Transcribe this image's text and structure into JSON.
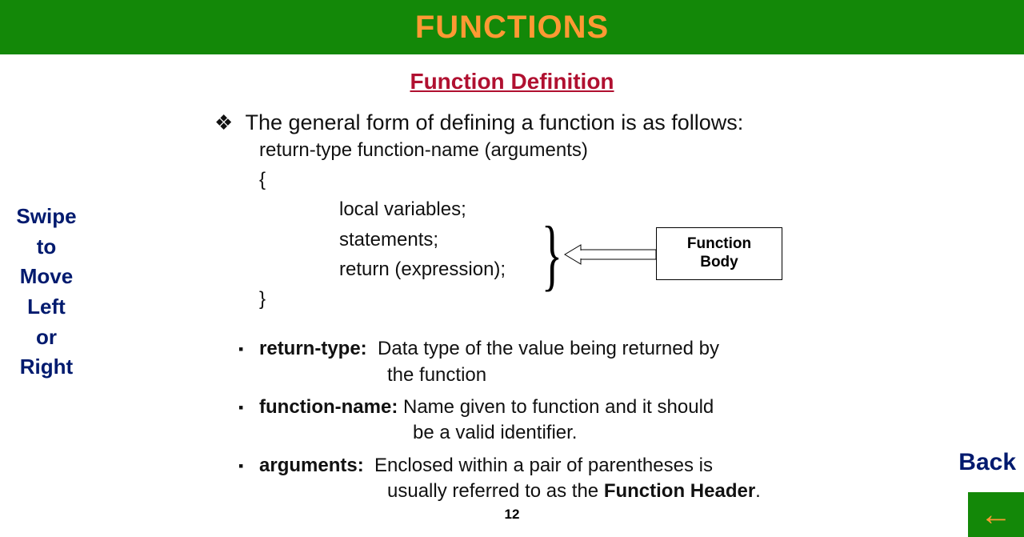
{
  "header": {
    "title": "FUNCTIONS"
  },
  "subtitle": "Function Definition",
  "swipe_hint": {
    "l1": "Swipe",
    "l2": "to",
    "l3": "Move",
    "l4": "Left",
    "l5": "or",
    "l6": "Right"
  },
  "lead": "The general form of defining a function is as follows:",
  "syntax": {
    "line1": "return-type   function-name (arguments)",
    "line2": "{",
    "line3": "local variables;",
    "line4": "statements;",
    "line5": "return (expression);",
    "line6": "}"
  },
  "callout": {
    "l1": "Function",
    "l2": "Body"
  },
  "defs": [
    {
      "label": "return-type:  ",
      "text_a": "Data type of the value being returned by",
      "text_b": "the function"
    },
    {
      "label": "function-name: ",
      "text_a": "Name given to function and it should",
      "text_b": "be a valid identifier."
    },
    {
      "label": "arguments:  ",
      "text_a": "Enclosed within a pair of parentheses is",
      "text_b": "usually referred to as the ",
      "text_bold": "Function Header",
      "text_after": "."
    }
  ],
  "page_number": "12",
  "back": {
    "label": "Back"
  },
  "bullets": {
    "diamond": "❖",
    "square": "▪"
  }
}
